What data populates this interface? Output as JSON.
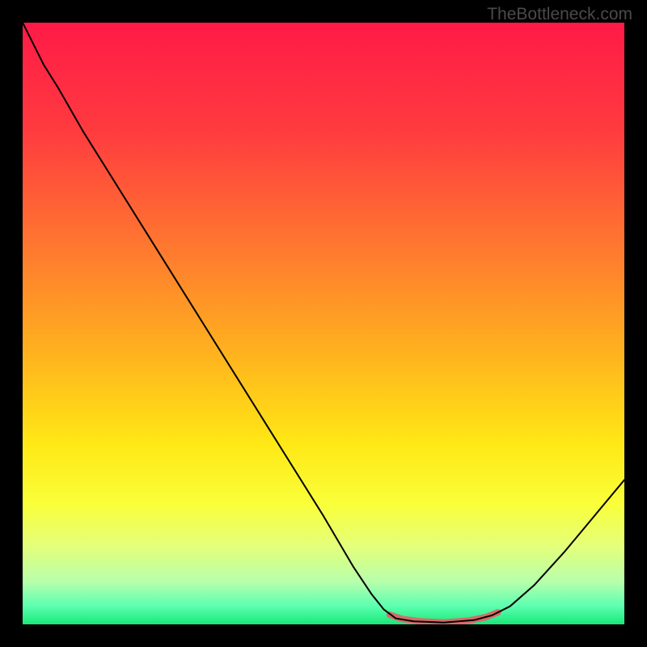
{
  "watermark": "TheBottleneck.com",
  "chart_data": {
    "type": "line",
    "title": "",
    "xlabel": "",
    "ylabel": "",
    "xlim": [
      0,
      100
    ],
    "ylim": [
      0,
      100
    ],
    "gradient_stops": [
      {
        "offset": 0,
        "color": "#ff1a47"
      },
      {
        "offset": 18,
        "color": "#ff3b3f"
      },
      {
        "offset": 38,
        "color": "#ff7a2f"
      },
      {
        "offset": 55,
        "color": "#ffb21e"
      },
      {
        "offset": 70,
        "color": "#ffe815"
      },
      {
        "offset": 80,
        "color": "#f9ff3a"
      },
      {
        "offset": 87,
        "color": "#e4ff7a"
      },
      {
        "offset": 93,
        "color": "#b6ffac"
      },
      {
        "offset": 97,
        "color": "#5bffb0"
      },
      {
        "offset": 100,
        "color": "#18e878"
      }
    ],
    "series": [
      {
        "name": "bottleneck-curve",
        "color": "#000000",
        "width": 2,
        "points": [
          {
            "x": 0,
            "y": 100
          },
          {
            "x": 3.5,
            "y": 93
          },
          {
            "x": 6,
            "y": 89
          },
          {
            "x": 10,
            "y": 82
          },
          {
            "x": 20,
            "y": 66
          },
          {
            "x": 30,
            "y": 50
          },
          {
            "x": 40,
            "y": 34
          },
          {
            "x": 50,
            "y": 18
          },
          {
            "x": 55,
            "y": 9.5
          },
          {
            "x": 58,
            "y": 5
          },
          {
            "x": 60,
            "y": 2.5
          },
          {
            "x": 62,
            "y": 1
          },
          {
            "x": 65,
            "y": 0.5
          },
          {
            "x": 70,
            "y": 0.3
          },
          {
            "x": 75,
            "y": 0.7
          },
          {
            "x": 78,
            "y": 1.5
          },
          {
            "x": 81,
            "y": 3
          },
          {
            "x": 85,
            "y": 6.5
          },
          {
            "x": 90,
            "y": 12
          },
          {
            "x": 95,
            "y": 18
          },
          {
            "x": 100,
            "y": 24
          }
        ]
      },
      {
        "name": "highlight-segment",
        "color": "#d96a6a",
        "width": 8,
        "points": [
          {
            "x": 61,
            "y": 1.6
          },
          {
            "x": 63,
            "y": 0.9
          },
          {
            "x": 66,
            "y": 0.5
          },
          {
            "x": 70,
            "y": 0.3
          },
          {
            "x": 74,
            "y": 0.6
          },
          {
            "x": 77,
            "y": 1.2
          },
          {
            "x": 79,
            "y": 2.0
          }
        ]
      }
    ]
  }
}
